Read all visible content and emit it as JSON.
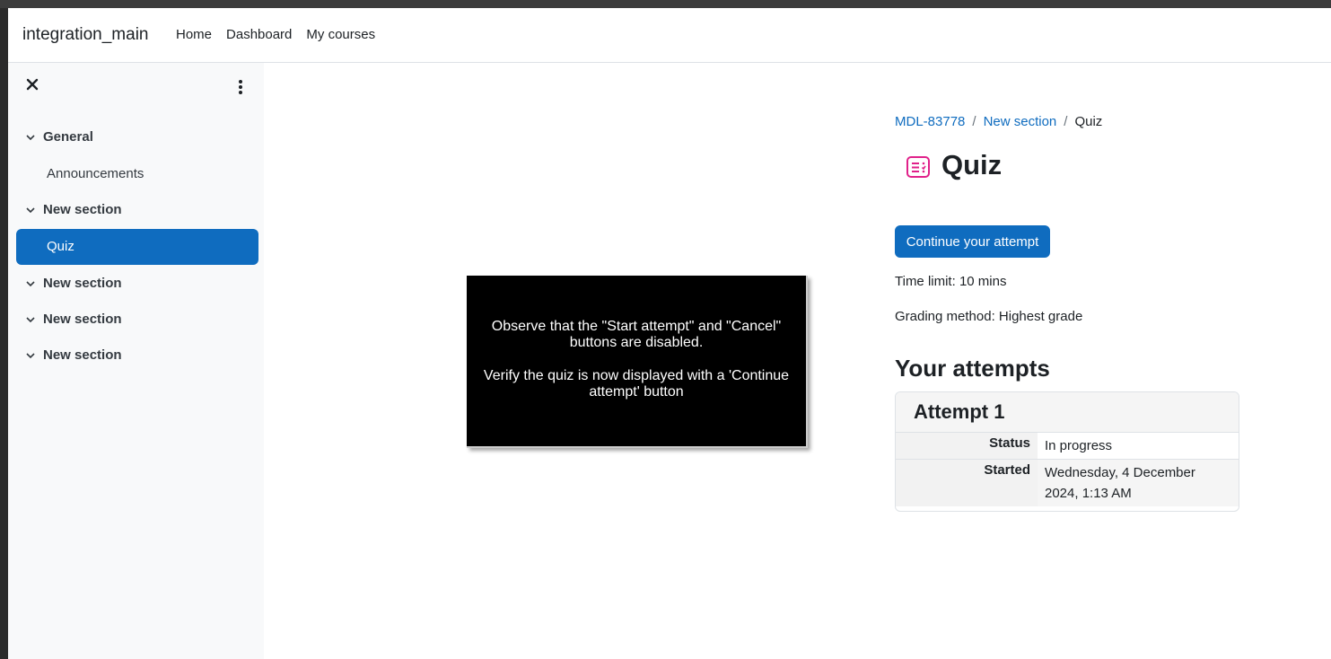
{
  "colors": {
    "primary": "#0f6cbf",
    "quiz_icon": "#e0218a",
    "overlay_background": "#000000"
  },
  "navbar": {
    "brand": "integration_main",
    "links": [
      "Home",
      "Dashboard",
      "My courses"
    ]
  },
  "drawer": {
    "close_icon": "close-icon",
    "menu_icon": "kebab-menu-icon",
    "course_index": {
      "sections": [
        {
          "title": "General",
          "activities": [
            "Announcements"
          ]
        },
        {
          "title": "New section",
          "activities": [
            "Quiz"
          ],
          "active_activity": "Quiz"
        },
        {
          "title": "New section",
          "activities": []
        },
        {
          "title": "New section",
          "activities": []
        },
        {
          "title": "New section",
          "activities": []
        }
      ]
    }
  },
  "breadcrumb": {
    "items": [
      "MDL-83778",
      "New section",
      "Quiz"
    ],
    "separator": "/"
  },
  "page": {
    "title": "Quiz",
    "icon": "quiz-icon",
    "continue_button": "Continue your attempt",
    "time_limit": "Time limit: 10 mins",
    "grading_method": "Grading method: Highest grade",
    "attempts_heading": "Your attempts"
  },
  "attempt": {
    "title": "Attempt 1",
    "status_label": "Status",
    "status_value": "In progress",
    "started_label": "Started",
    "started_value": "Wednesday, 4 December 2024, 1:13 AM"
  },
  "overlay": {
    "line1": "Observe that the \"Start attempt\" and \"Cancel\" buttons are disabled.",
    "line2": "Verify the quiz is now displayed with a 'Continue attempt' button"
  }
}
